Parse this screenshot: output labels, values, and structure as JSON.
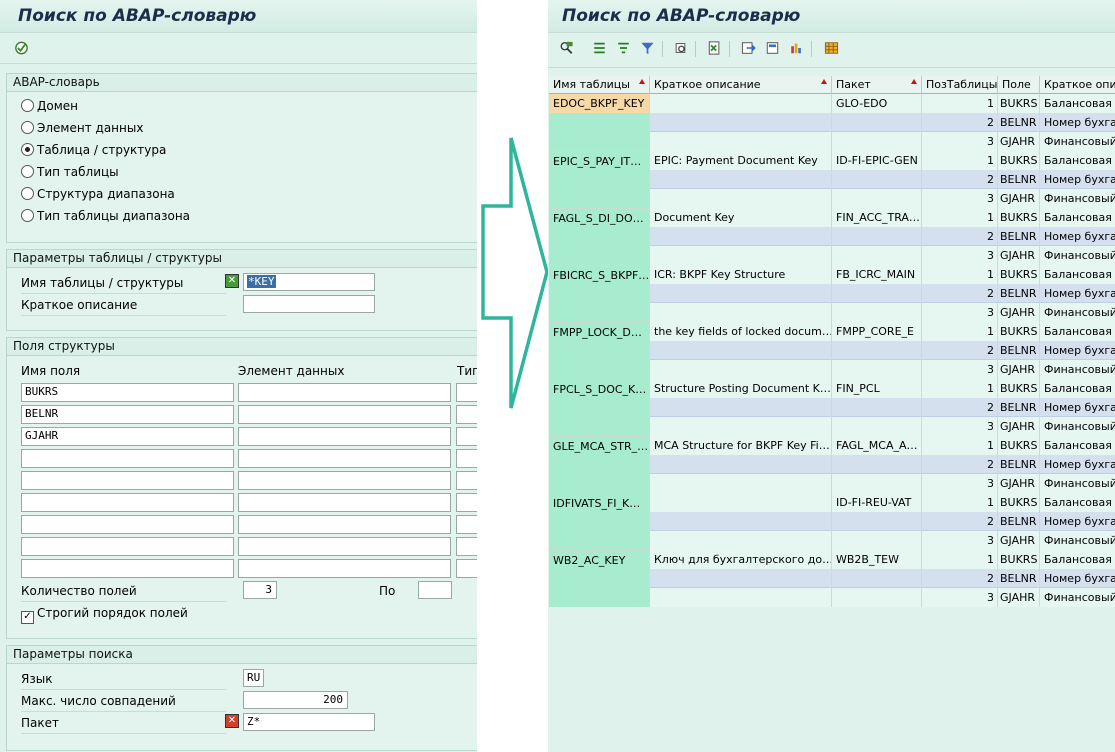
{
  "left": {
    "title": "Поиск по ABAP-словарю",
    "dictionary_group": {
      "header": "ABAP-словарь",
      "options": [
        {
          "label": "Домен",
          "selected": false
        },
        {
          "label": "Элемент данных",
          "selected": false
        },
        {
          "label": "Таблица / структура",
          "selected": true
        },
        {
          "label": "Тип таблицы",
          "selected": false
        },
        {
          "label": "Структура диапазона",
          "selected": false
        },
        {
          "label": "Тип таблицы диапазона",
          "selected": false
        }
      ]
    },
    "table_params": {
      "header": "Параметры таблицы / структуры",
      "name_label": "Имя таблицы / структуры",
      "name_value": "*KEY",
      "desc_label": "Краткое описание",
      "desc_value": ""
    },
    "struct_fields": {
      "header": "Поля структуры",
      "col_field": "Имя поля",
      "col_element": "Элемент данных",
      "col_type": "Тип",
      "rows": [
        "BUKRS",
        "BELNR",
        "GJAHR",
        "",
        "",
        "",
        "",
        "",
        ""
      ],
      "count_label": "Количество полей",
      "count_value": "3",
      "to_label": "По",
      "to_value": "",
      "strict_label": "Строгий порядок полей",
      "strict_checked": "✓"
    },
    "search_params": {
      "header": "Параметры поиска",
      "lang_label": "Язык",
      "lang_value": "RU",
      "max_label": "Макс. число совпадений",
      "max_value": "200",
      "pkg_label": "Пакет",
      "pkg_value": "Z*"
    }
  },
  "right": {
    "title": "Поиск по ABAP-словарю",
    "columns": [
      "Имя таблицы",
      "Краткое описание",
      "Пакет",
      "ПозТаблицы",
      "Поле",
      "Краткое описание"
    ],
    "groups": [
      {
        "table": "EDOC_BKPF_KEY",
        "desc": "",
        "pkg": "GLO-EDO"
      },
      {
        "table": "EPIC_S_PAY_IT…",
        "desc": "EPIC: Payment Document Key",
        "pkg": "ID-FI-EPIC-GEN"
      },
      {
        "table": "FAGL_S_DI_DO…",
        "desc": "Document Key",
        "pkg": "FIN_ACC_TRA…"
      },
      {
        "table": "FBICRC_S_BKPF…",
        "desc": "ICR: BKPF Key Structure",
        "pkg": "FB_ICRC_MAIN"
      },
      {
        "table": "FMPP_LOCK_D…",
        "desc": "the key fields of locked docum…",
        "pkg": "FMPP_CORE_E"
      },
      {
        "table": "FPCL_S_DOC_K…",
        "desc": "Structure Posting Document K…",
        "pkg": "FIN_PCL"
      },
      {
        "table": "GLE_MCA_STR_…",
        "desc": "MCA Structure for BKPF Key Fi…",
        "pkg": "FAGL_MCA_A…"
      },
      {
        "table": "IDFIVATS_FI_K…",
        "desc": "",
        "pkg": "ID-FI-REU-VAT"
      },
      {
        "table": "WB2_AC_KEY",
        "desc": "Ключ для бухгалтерского до…",
        "pkg": "WB2B_TEW"
      }
    ],
    "fields": [
      {
        "pos": "1",
        "field": "BUKRS",
        "desc": "Балансовая"
      },
      {
        "pos": "2",
        "field": "BELNR",
        "desc": "Номер бухга"
      },
      {
        "pos": "3",
        "field": "GJAHR",
        "desc": "Финансовый"
      }
    ]
  },
  "colors": {
    "arrow": "#2fb59c",
    "row_selected": "#f7d9a8",
    "row_blue": "#d5e0ef",
    "key_col": "#a8ecd0"
  }
}
